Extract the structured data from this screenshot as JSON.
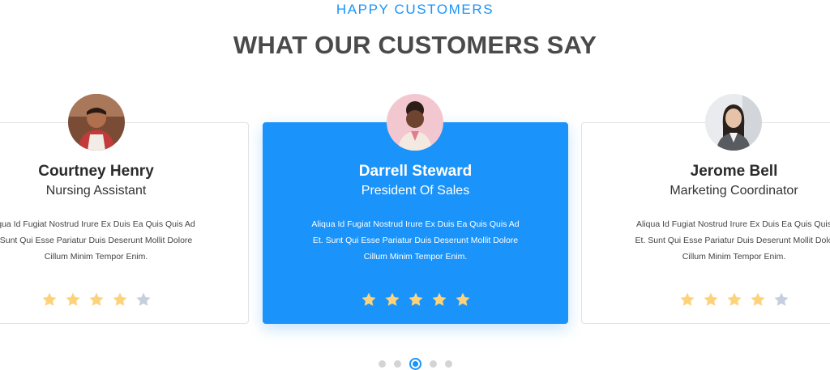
{
  "section": {
    "eyebrow": "HAPPY CUSTOMERS",
    "title": "WHAT OUR CUSTOMERS SAY"
  },
  "testimonials": [
    {
      "name": "Courtney Henry",
      "role": "Nursing Assistant",
      "quote": "...qua Id Fugiat Nostrud Irure Ex Duis Ea Quis Quis Ad ...Sunt Qui Esse Pariatur Duis Deserunt Mollit Dolore Cillum Minim Tempor Enim.",
      "quote_lines": [
        "qua Id Fugiat Nostrud Irure Ex Duis Ea Quis Quis Ad",
        "Sunt Qui Esse Pariatur Duis Deserunt Mollit Dolore",
        "Cillum Minim Tempor Enim."
      ],
      "rating": 4,
      "rating_max": 5,
      "avatar_icon": "person-avatar"
    },
    {
      "name": "Darrell Steward",
      "role": "President Of Sales",
      "quote_lines": [
        "Aliqua Id Fugiat Nostrud Irure Ex Duis Ea Quis Quis Ad",
        "Et. Sunt Qui Esse Pariatur Duis Deserunt Mollit Dolore",
        "Cillum Minim Tempor Enim."
      ],
      "rating": 5,
      "rating_max": 5,
      "avatar_icon": "person-avatar"
    },
    {
      "name": "Jerome Bell",
      "role": "Marketing Coordinator",
      "quote_lines": [
        "Aliqua Id Fugiat Nostrud Irure Ex Duis Ea Quis Quis",
        "Et. Sunt Qui Esse Pariatur Duis Deserunt Mollit Dolo",
        "Cillum Minim Tempor Enim."
      ],
      "rating": 4,
      "rating_max": 5,
      "avatar_icon": "person-avatar"
    }
  ],
  "pagination": {
    "count": 5,
    "active_index": 2
  },
  "colors": {
    "accent": "#1a93fb",
    "heading": "#4a4a4a",
    "star_filled": "#fcd37a",
    "star_empty": "#c6cfdd",
    "dot_inactive": "#d4d4d4"
  }
}
